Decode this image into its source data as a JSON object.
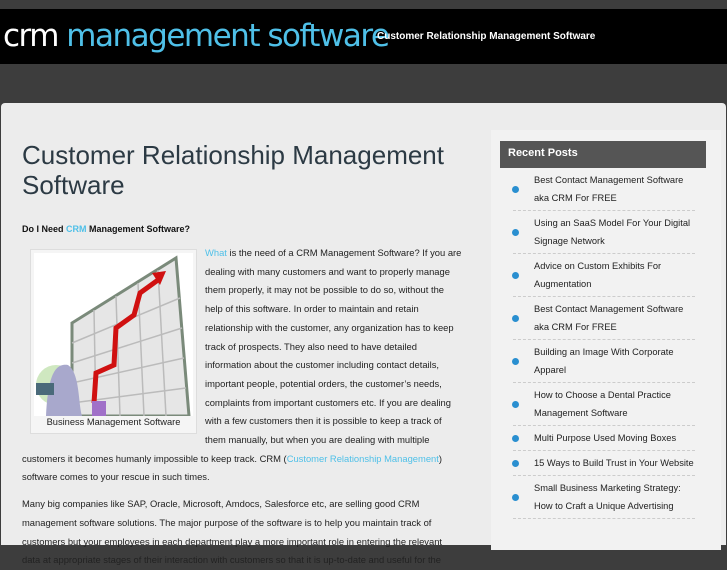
{
  "header": {
    "logo_part1": "crm",
    "logo_part2": " management software",
    "tagline": "Customer Relationship Management Software"
  },
  "main": {
    "title": "Customer Relationship Management Software",
    "subhead": {
      "pre": "Do I Need ",
      "link": "CRM",
      "post": " Management Software?"
    },
    "figure_caption": "Business Management Software",
    "p1": {
      "link": "What",
      "text": " is the need of a CRM Management Software? If you are dealing with many customers and want to properly manage them properly, it may not be possible to do so, without the help of this software. In order to maintain and retain relationship with the customer, any organization has to keep track of prospects. They also need to have detailed information about the customer including contact details, important people, potential orders, the customer’s needs, complaints from important customers etc. If you are dealing with a few customers then it is possible to keep a track of them manually, but when you are dealing with multiple customers it becomes humanly impossible to keep track. CRM (",
      "link2": "Customer Relationship Management",
      "text2": ") software comes to your rescue in such times."
    },
    "p2": "Many big companies like SAP, Oracle, Microsoft, Amdocs, Salesforce etc, are selling good CRM management software solutions. The major purpose of the software is to help you maintain track of customers but your employees in each department play a more important role in entering the relevant data at appropriate stages of their interaction with customers so that it is up-to-date and useful for the"
  },
  "sidebar": {
    "heading": "Recent Posts",
    "posts": [
      "Best Contact Management Software aka CRM For FREE",
      "Using an SaaS Model For Your Digital Signage Network",
      "Advice on Custom Exhibits For Augmentation",
      "Best Contact Management Software aka CRM For FREE",
      "Building an Image With Corporate Apparel",
      "How to Choose a Dental Practice Management Software",
      "Multi Purpose Used Moving Boxes",
      "15 Ways to Build Trust in Your Website",
      "Small Business Marketing Strategy: How to Craft a Unique Advertising"
    ]
  }
}
